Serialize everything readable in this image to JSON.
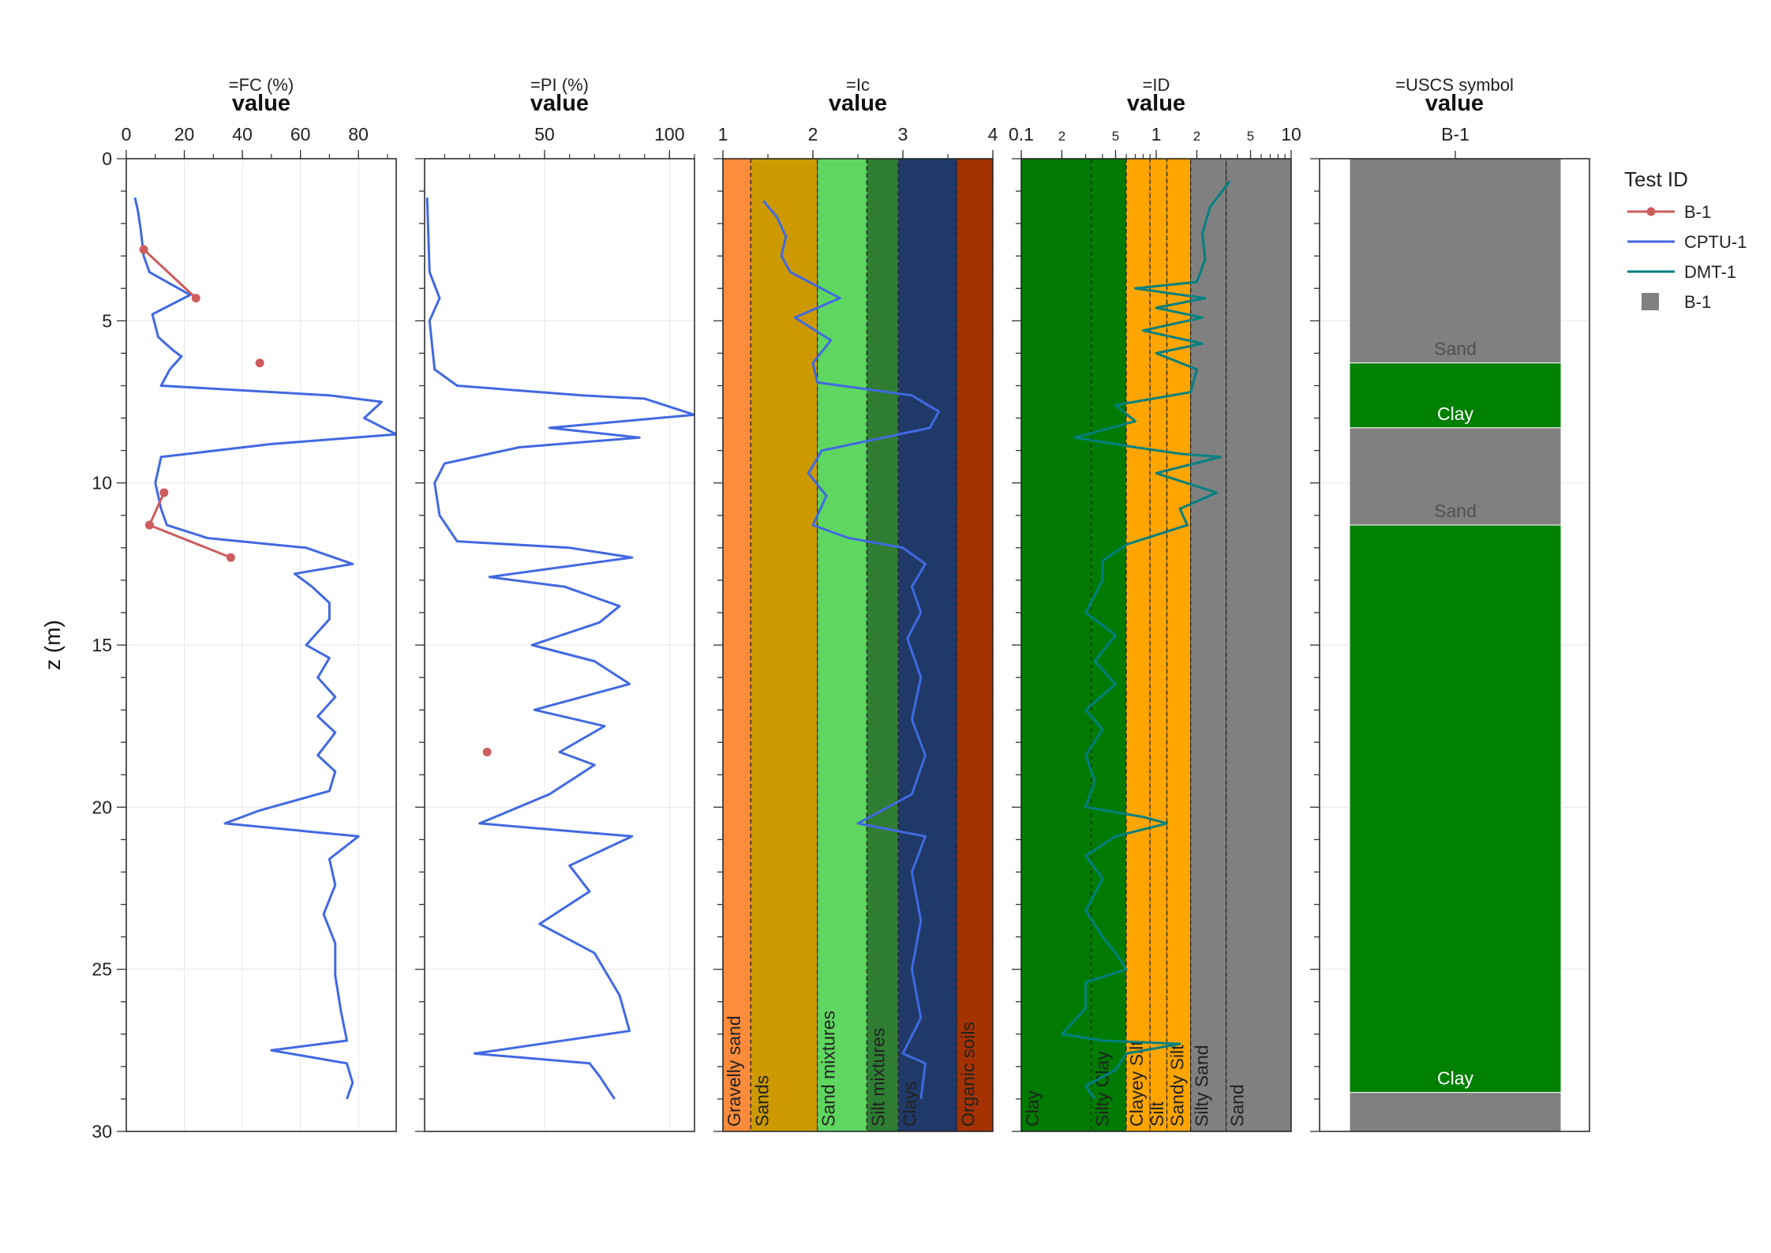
{
  "chart_data": [
    {
      "type": "line",
      "panel_title": "=FC (%)",
      "axis_label": "value",
      "ylabel": "z (m)",
      "xlim": [
        0,
        93
      ],
      "ylim": [
        30,
        0
      ],
      "x_ticks": [
        "0",
        "20",
        "40",
        "60",
        "80"
      ],
      "y_ticks": [
        "0",
        "5",
        "10",
        "15",
        "20",
        "25",
        "30"
      ],
      "series": [
        {
          "name": "CPTU-1",
          "color": "#4169e1",
          "points": [
            [
              3,
              1.2
            ],
            [
              4,
              1.6
            ],
            [
              5,
              2.2
            ],
            [
              6,
              3.0
            ],
            [
              8,
              3.5
            ],
            [
              16,
              3.9
            ],
            [
              22,
              4.2
            ],
            [
              9,
              4.8
            ],
            [
              11,
              5.5
            ],
            [
              16,
              5.9
            ],
            [
              19,
              6.1
            ],
            [
              15,
              6.5
            ],
            [
              12,
              7.0
            ],
            [
              70,
              7.3
            ],
            [
              88,
              7.5
            ],
            [
              82,
              8.0
            ],
            [
              93,
              8.5
            ],
            [
              50,
              8.8
            ],
            [
              12,
              9.2
            ],
            [
              11,
              9.6
            ],
            [
              10,
              10.0
            ],
            [
              12,
              10.8
            ],
            [
              14,
              11.3
            ],
            [
              28,
              11.7
            ],
            [
              62,
              12.0
            ],
            [
              78,
              12.5
            ],
            [
              58,
              12.8
            ],
            [
              64,
              13.2
            ],
            [
              70,
              13.7
            ],
            [
              70,
              14.2
            ],
            [
              62,
              15.0
            ],
            [
              70,
              15.4
            ],
            [
              66,
              16.0
            ],
            [
              72,
              16.6
            ],
            [
              66,
              17.2
            ],
            [
              72,
              17.7
            ],
            [
              66,
              18.4
            ],
            [
              72,
              18.9
            ],
            [
              70,
              19.5
            ],
            [
              46,
              20.1
            ],
            [
              34,
              20.5
            ],
            [
              80,
              20.9
            ],
            [
              70,
              21.6
            ],
            [
              72,
              22.4
            ],
            [
              68,
              23.3
            ],
            [
              72,
              24.2
            ],
            [
              72,
              25.2
            ],
            [
              74,
              26.3
            ],
            [
              76,
              27.2
            ],
            [
              50,
              27.5
            ],
            [
              76,
              27.9
            ],
            [
              78,
              28.5
            ],
            [
              76,
              29.0
            ]
          ]
        },
        {
          "name": "B-1",
          "color": "#cd5c5c",
          "markers": true,
          "points": [
            [
              6,
              2.8
            ],
            [
              24,
              4.3
            ]
          ]
        },
        {
          "name": "B-1",
          "color": "#cd5c5c",
          "markers": true,
          "points": [
            [
              46,
              6.3
            ]
          ]
        },
        {
          "name": "B-1",
          "color": "#cd5c5c",
          "markers": true,
          "points": [
            [
              13,
              10.3
            ],
            [
              8,
              11.3
            ],
            [
              36,
              12.3
            ]
          ]
        }
      ]
    },
    {
      "type": "line",
      "panel_title": "=PI (%)",
      "axis_label": "value",
      "xlim": [
        2,
        110
      ],
      "ylim": [
        30,
        0
      ],
      "x_ticks": [
        "50",
        "100"
      ],
      "series": [
        {
          "name": "CPTU-1",
          "color": "#4169e1",
          "points": [
            [
              3,
              1.2
            ],
            [
              4,
              3.5
            ],
            [
              8,
              4.3
            ],
            [
              4,
              5.0
            ],
            [
              6,
              6.5
            ],
            [
              15,
              7.0
            ],
            [
              65,
              7.3
            ],
            [
              90,
              7.4
            ],
            [
              110,
              7.9
            ],
            [
              52,
              8.3
            ],
            [
              88,
              8.6
            ],
            [
              40,
              8.9
            ],
            [
              10,
              9.4
            ],
            [
              6,
              10.0
            ],
            [
              8,
              11.0
            ],
            [
              15,
              11.8
            ],
            [
              60,
              12.0
            ],
            [
              85,
              12.3
            ],
            [
              28,
              12.9
            ],
            [
              58,
              13.2
            ],
            [
              80,
              13.8
            ],
            [
              72,
              14.3
            ],
            [
              45,
              15.0
            ],
            [
              70,
              15.5
            ],
            [
              84,
              16.2
            ],
            [
              46,
              17.0
            ],
            [
              74,
              17.5
            ],
            [
              56,
              18.3
            ],
            [
              70,
              18.7
            ],
            [
              52,
              19.6
            ],
            [
              24,
              20.5
            ],
            [
              85,
              20.9
            ],
            [
              60,
              21.8
            ],
            [
              68,
              22.6
            ],
            [
              48,
              23.6
            ],
            [
              70,
              24.5
            ],
            [
              80,
              25.8
            ],
            [
              84,
              26.9
            ],
            [
              22,
              27.6
            ],
            [
              68,
              27.9
            ],
            [
              72,
              28.3
            ],
            [
              78,
              29.0
            ]
          ]
        },
        {
          "name": "B-1",
          "color": "#cd5c5c",
          "markers": true,
          "points": [
            [
              27,
              18.3
            ]
          ]
        }
      ]
    },
    {
      "type": "line",
      "panel_title": "=Ic",
      "axis_label": "value",
      "xlim": [
        1,
        4
      ],
      "ylim": [
        30,
        0
      ],
      "x_ticks": [
        "1",
        "2",
        "3",
        "4"
      ],
      "zones": [
        {
          "from": 1.0,
          "to": 1.31,
          "color": "#ff8c3c",
          "label": "Gravelly sand"
        },
        {
          "from": 1.31,
          "to": 2.05,
          "color": "#cc9900",
          "label": "Sands"
        },
        {
          "from": 2.05,
          "to": 2.6,
          "color": "#5fd65f",
          "label": "Sand mixtures"
        },
        {
          "from": 2.6,
          "to": 2.95,
          "color": "#2e7d32",
          "label": "Silt mixtures"
        },
        {
          "from": 2.95,
          "to": 3.6,
          "color": "#1f3a68",
          "label": "Clays"
        },
        {
          "from": 3.6,
          "to": 4.0,
          "color": "#a33200",
          "label": "Organic soils"
        }
      ],
      "series": [
        {
          "name": "CPTU-1",
          "color": "#4169e1",
          "points": [
            [
              1.45,
              1.3
            ],
            [
              1.6,
              1.8
            ],
            [
              1.7,
              2.4
            ],
            [
              1.65,
              3.0
            ],
            [
              1.75,
              3.5
            ],
            [
              2.3,
              4.3
            ],
            [
              1.8,
              4.9
            ],
            [
              2.2,
              5.6
            ],
            [
              2.0,
              6.3
            ],
            [
              2.05,
              6.9
            ],
            [
              3.1,
              7.3
            ],
            [
              3.4,
              7.8
            ],
            [
              3.3,
              8.3
            ],
            [
              2.1,
              9.0
            ],
            [
              1.95,
              9.7
            ],
            [
              2.15,
              10.4
            ],
            [
              2.0,
              11.3
            ],
            [
              2.4,
              11.7
            ],
            [
              3.0,
              12.0
            ],
            [
              3.25,
              12.5
            ],
            [
              3.1,
              13.2
            ],
            [
              3.2,
              14.0
            ],
            [
              3.05,
              14.8
            ],
            [
              3.2,
              16.0
            ],
            [
              3.1,
              17.3
            ],
            [
              3.25,
              18.4
            ],
            [
              3.1,
              19.6
            ],
            [
              2.5,
              20.5
            ],
            [
              3.25,
              20.9
            ],
            [
              3.1,
              22.0
            ],
            [
              3.2,
              23.5
            ],
            [
              3.1,
              25.0
            ],
            [
              3.2,
              26.5
            ],
            [
              3.0,
              27.6
            ],
            [
              3.25,
              27.9
            ],
            [
              3.2,
              29.0
            ]
          ]
        }
      ]
    },
    {
      "type": "line",
      "panel_title": "=ID",
      "axis_label": "value",
      "xscale": "log",
      "xlim": [
        0.1,
        10
      ],
      "ylim": [
        30,
        0
      ],
      "x_ticks": [
        {
          "v": 0.1,
          "label": "0.1"
        },
        {
          "v": 0.2,
          "label": "2"
        },
        {
          "v": 0.5,
          "label": "5"
        },
        {
          "v": 1,
          "label": "1"
        },
        {
          "v": 2,
          "label": "2"
        },
        {
          "v": 5,
          "label": "5"
        },
        {
          "v": 10,
          "label": "10"
        }
      ],
      "zones": [
        {
          "from": 0.1,
          "to": 0.33,
          "color": "#007a00",
          "label": "Clay"
        },
        {
          "from": 0.33,
          "to": 0.6,
          "color": "#007a00",
          "label": "Silty Clay"
        },
        {
          "from": 0.6,
          "to": 0.9,
          "color": "#ffa500",
          "label": "Clayey Silt"
        },
        {
          "from": 0.9,
          "to": 1.2,
          "color": "#ffa500",
          "label": "Silt"
        },
        {
          "from": 1.2,
          "to": 1.8,
          "color": "#ffa500",
          "label": "Sandy Silt"
        },
        {
          "from": 1.8,
          "to": 3.3,
          "color": "#808080",
          "label": "Silty Sand"
        },
        {
          "from": 3.3,
          "to": 10,
          "color": "#808080",
          "label": "Sand"
        }
      ],
      "series": [
        {
          "name": "DMT-1",
          "color": "#008080",
          "points": [
            [
              3.5,
              0.7
            ],
            [
              2.5,
              1.5
            ],
            [
              2.2,
              2.3
            ],
            [
              2.3,
              3.1
            ],
            [
              2.0,
              3.8
            ],
            [
              0.7,
              4.0
            ],
            [
              2.3,
              4.3
            ],
            [
              1.0,
              4.6
            ],
            [
              2.2,
              4.9
            ],
            [
              0.8,
              5.3
            ],
            [
              2.2,
              5.7
            ],
            [
              1.0,
              6.0
            ],
            [
              2.0,
              6.5
            ],
            [
              1.8,
              7.2
            ],
            [
              0.5,
              7.6
            ],
            [
              0.7,
              8.1
            ],
            [
              0.25,
              8.6
            ],
            [
              0.7,
              8.9
            ],
            [
              1.5,
              9.1
            ],
            [
              3.0,
              9.2
            ],
            [
              1.0,
              9.7
            ],
            [
              2.8,
              10.3
            ],
            [
              1.5,
              10.8
            ],
            [
              1.7,
              11.3
            ],
            [
              0.6,
              11.9
            ],
            [
              0.4,
              12.4
            ],
            [
              0.4,
              13.0
            ],
            [
              0.3,
              14.0
            ],
            [
              0.5,
              14.7
            ],
            [
              0.35,
              15.5
            ],
            [
              0.5,
              16.2
            ],
            [
              0.3,
              17.0
            ],
            [
              0.4,
              17.6
            ],
            [
              0.3,
              18.4
            ],
            [
              0.35,
              19.2
            ],
            [
              0.3,
              20.0
            ],
            [
              0.8,
              20.3
            ],
            [
              1.2,
              20.5
            ],
            [
              0.5,
              20.9
            ],
            [
              0.3,
              21.5
            ],
            [
              0.4,
              22.2
            ],
            [
              0.3,
              23.2
            ],
            [
              0.4,
              24.0
            ],
            [
              0.5,
              24.5
            ],
            [
              0.6,
              25.0
            ],
            [
              0.3,
              25.4
            ],
            [
              0.3,
              26.2
            ],
            [
              0.2,
              27.0
            ],
            [
              0.4,
              27.2
            ],
            [
              1.5,
              27.3
            ],
            [
              0.6,
              27.6
            ],
            [
              0.5,
              28.1
            ],
            [
              0.3,
              28.6
            ],
            [
              0.35,
              29.0
            ]
          ]
        }
      ]
    },
    {
      "type": "bar",
      "panel_title": "=USCS symbol",
      "axis_label": "value",
      "ylim": [
        30,
        0
      ],
      "categories": [
        "B-1"
      ],
      "layers": [
        {
          "top": 0,
          "bottom": 6.3,
          "label": "Sand",
          "color": "#808080",
          "label_color": "#505050"
        },
        {
          "top": 6.3,
          "bottom": 8.3,
          "label": "Clay",
          "color": "#008000",
          "label_color": "#ffffff"
        },
        {
          "top": 8.3,
          "bottom": 11.3,
          "label": "Sand",
          "color": "#808080",
          "label_color": "#505050"
        },
        {
          "top": 11.3,
          "bottom": 28.8,
          "label": "Clay",
          "color": "#008000",
          "label_color": "#ffffff"
        },
        {
          "top": 28.8,
          "bottom": 30,
          "label": "",
          "color": "#808080",
          "label_color": "#505050"
        }
      ]
    }
  ],
  "legend": {
    "title": "Test ID",
    "items": [
      {
        "label": "B-1",
        "color": "#cd5c5c",
        "kind": "line-marker"
      },
      {
        "label": "CPTU-1",
        "color": "#4169e1",
        "kind": "line"
      },
      {
        "label": "DMT-1",
        "color": "#008080",
        "kind": "line"
      },
      {
        "label": "B-1",
        "color": "#808080",
        "kind": "square"
      }
    ]
  }
}
